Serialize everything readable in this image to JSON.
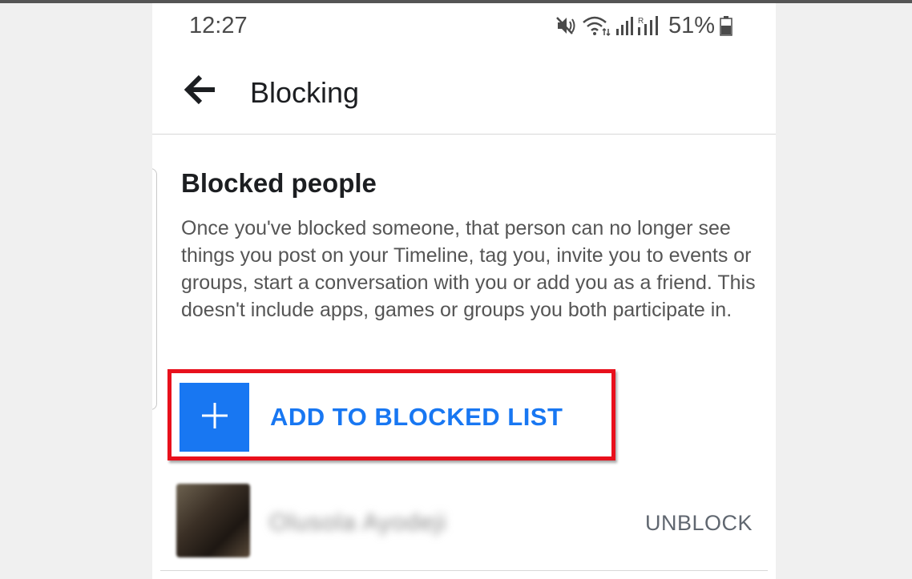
{
  "status_bar": {
    "time": "12:27",
    "battery": "51%",
    "icons": [
      "mute-icon",
      "wifi-icon",
      "signal-icon",
      "roaming-signal-icon",
      "battery-icon"
    ]
  },
  "app_bar": {
    "back_icon": "back-arrow-icon",
    "title": "Blocking"
  },
  "section": {
    "title": "Blocked people",
    "description": "Once you've blocked someone, that person can no longer see things you post on your Timeline, tag you, invite you to events or groups, start a conversation with you or add you as a friend. This doesn't include apps, games or groups you both participate in."
  },
  "add_button": {
    "icon": "plus-icon",
    "label": "ADD TO BLOCKED LIST"
  },
  "blocked_list": [
    {
      "name": "Olusola Ayodeji",
      "action": "UNBLOCK"
    }
  ],
  "colors": {
    "accent": "#1877f2",
    "highlight": "#e8101c",
    "text_primary": "#1c1e21",
    "text_secondary": "#555555"
  }
}
